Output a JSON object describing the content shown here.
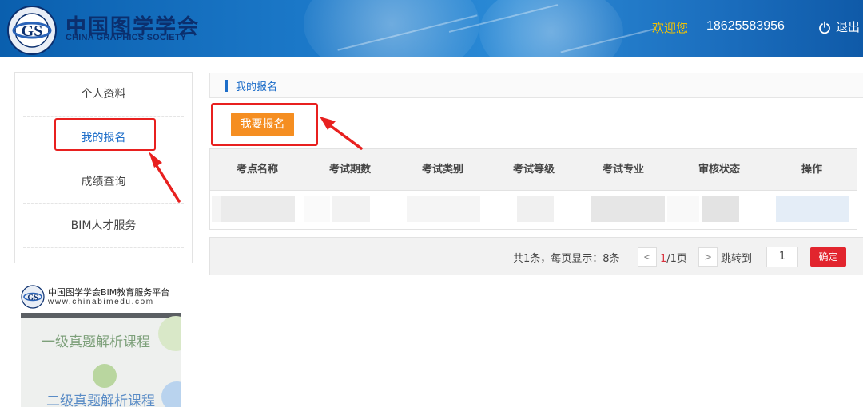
{
  "header": {
    "logo_cn": "中国图学学会",
    "logo_en": "CHINA GRAPHICS SOCIETY",
    "welcome": "欢迎您",
    "phone": "18625583956",
    "logout": "退出",
    "icon": "power-icon"
  },
  "sidebar": {
    "items": [
      {
        "label": "个人资料",
        "active": false
      },
      {
        "label": "我的报名",
        "active": true
      },
      {
        "label": "成绩查询",
        "active": false
      },
      {
        "label": "BIM人才服务",
        "active": false
      }
    ]
  },
  "promo": {
    "title": "中国图学学会BIM教育服务平台",
    "url": "www.chinabimedu.com",
    "course1": "一级真题解析课程",
    "course2": "二级真题解析课程"
  },
  "breadcrumb": {
    "label": "我的报名"
  },
  "apply_button": "我要报名",
  "table": {
    "headers": [
      "考点名称",
      "考试期数",
      "考试类别",
      "考试等级",
      "考试专业",
      "审核状态",
      "操作"
    ]
  },
  "pager": {
    "total": "共1条，每页显示：8条",
    "prev": "<",
    "current": "1",
    "pages": "/1页",
    "next": ">",
    "jump_label": "跳转到",
    "jump_value": "1",
    "confirm": "确定"
  },
  "colors": {
    "accent": "#1e6ec9",
    "apply_button": "#f58e21",
    "confirm_button": "#e2252e",
    "annotation": "#e8201f",
    "welcome": "#f5c400"
  }
}
